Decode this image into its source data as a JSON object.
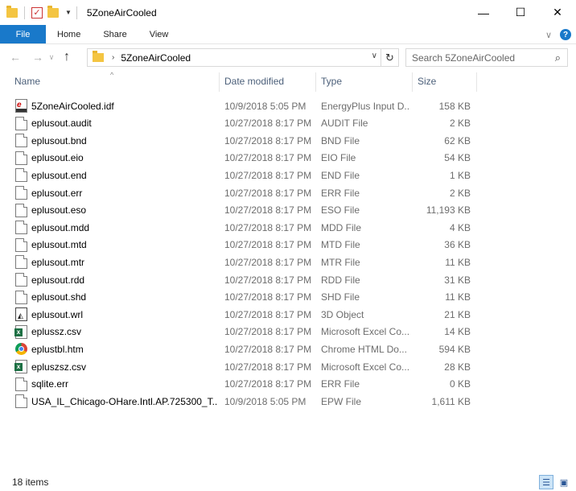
{
  "window": {
    "title": "5ZoneAirCooled",
    "minimize": "—",
    "maximize": "☐",
    "close": "✕"
  },
  "ribbon": {
    "tabs": [
      "File",
      "Home",
      "Share",
      "View"
    ],
    "chevron": "∨",
    "help": "?"
  },
  "nav": {
    "back": "←",
    "forward": "→",
    "recent": "∨",
    "up": "↑",
    "address_sep": "›",
    "address": "5ZoneAirCooled",
    "address_dropdown": "∨",
    "refresh": "↻",
    "search_placeholder": "Search 5ZoneAirCooled",
    "search_icon": "⌕"
  },
  "columns": {
    "name": "Name",
    "date": "Date modified",
    "type": "Type",
    "size": "Size",
    "sort_arrow": "^"
  },
  "files": [
    {
      "name": "5ZoneAirCooled.idf",
      "date": "10/9/2018 5:05 PM",
      "type": "EnergyPlus Input D...",
      "size": "158 KB",
      "icon": "idf"
    },
    {
      "name": "eplusout.audit",
      "date": "10/27/2018 8:17 PM",
      "type": "AUDIT File",
      "size": "2 KB",
      "icon": "doc"
    },
    {
      "name": "eplusout.bnd",
      "date": "10/27/2018 8:17 PM",
      "type": "BND File",
      "size": "62 KB",
      "icon": "doc"
    },
    {
      "name": "eplusout.eio",
      "date": "10/27/2018 8:17 PM",
      "type": "EIO File",
      "size": "54 KB",
      "icon": "doc"
    },
    {
      "name": "eplusout.end",
      "date": "10/27/2018 8:17 PM",
      "type": "END File",
      "size": "1 KB",
      "icon": "doc"
    },
    {
      "name": "eplusout.err",
      "date": "10/27/2018 8:17 PM",
      "type": "ERR File",
      "size": "2 KB",
      "icon": "doc"
    },
    {
      "name": "eplusout.eso",
      "date": "10/27/2018 8:17 PM",
      "type": "ESO File",
      "size": "11,193 KB",
      "icon": "doc"
    },
    {
      "name": "eplusout.mdd",
      "date": "10/27/2018 8:17 PM",
      "type": "MDD File",
      "size": "4 KB",
      "icon": "doc"
    },
    {
      "name": "eplusout.mtd",
      "date": "10/27/2018 8:17 PM",
      "type": "MTD File",
      "size": "36 KB",
      "icon": "doc"
    },
    {
      "name": "eplusout.mtr",
      "date": "10/27/2018 8:17 PM",
      "type": "MTR File",
      "size": "11 KB",
      "icon": "doc"
    },
    {
      "name": "eplusout.rdd",
      "date": "10/27/2018 8:17 PM",
      "type": "RDD File",
      "size": "31 KB",
      "icon": "doc"
    },
    {
      "name": "eplusout.shd",
      "date": "10/27/2018 8:17 PM",
      "type": "SHD File",
      "size": "11 KB",
      "icon": "doc"
    },
    {
      "name": "eplusout.wrl",
      "date": "10/27/2018 8:17 PM",
      "type": "3D Object",
      "size": "21 KB",
      "icon": "obj"
    },
    {
      "name": "eplussz.csv",
      "date": "10/27/2018 8:17 PM",
      "type": "Microsoft Excel Co...",
      "size": "14 KB",
      "icon": "excel"
    },
    {
      "name": "eplustbl.htm",
      "date": "10/27/2018 8:17 PM",
      "type": "Chrome HTML Do...",
      "size": "594 KB",
      "icon": "chrome"
    },
    {
      "name": "epluszsz.csv",
      "date": "10/27/2018 8:17 PM",
      "type": "Microsoft Excel Co...",
      "size": "28 KB",
      "icon": "excel"
    },
    {
      "name": "sqlite.err",
      "date": "10/27/2018 8:17 PM",
      "type": "ERR File",
      "size": "0 KB",
      "icon": "doc"
    },
    {
      "name": "USA_IL_Chicago-OHare.Intl.AP.725300_T...",
      "date": "10/9/2018 5:05 PM",
      "type": "EPW File",
      "size": "1,611 KB",
      "icon": "doc"
    }
  ],
  "status": {
    "count": "18 items",
    "details_view": "☰",
    "icons_view": "▣"
  }
}
